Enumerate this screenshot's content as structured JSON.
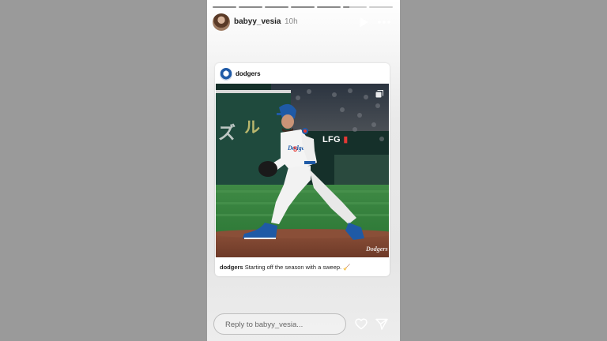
{
  "story": {
    "progress": [
      1,
      1,
      1,
      1,
      1,
      0.25,
      0
    ],
    "username": "babyy_vesia",
    "time": "10h"
  },
  "post": {
    "account": "dodgers",
    "overlay_text": "LFG",
    "caption_user": "dodgers",
    "caption_text": "Starting off the season with a sweep. 🧹",
    "jersey_brand": "Dodgers"
  },
  "reply": {
    "placeholder": "Reply to babyy_vesia..."
  },
  "icons": {
    "play": "play-icon",
    "more": "more-icon",
    "heart": "heart-icon",
    "send": "send-icon",
    "carousel": "carousel-icon"
  },
  "colors": {
    "dodger_blue": "#1f5aa6",
    "lfg_red": "#e53935"
  }
}
